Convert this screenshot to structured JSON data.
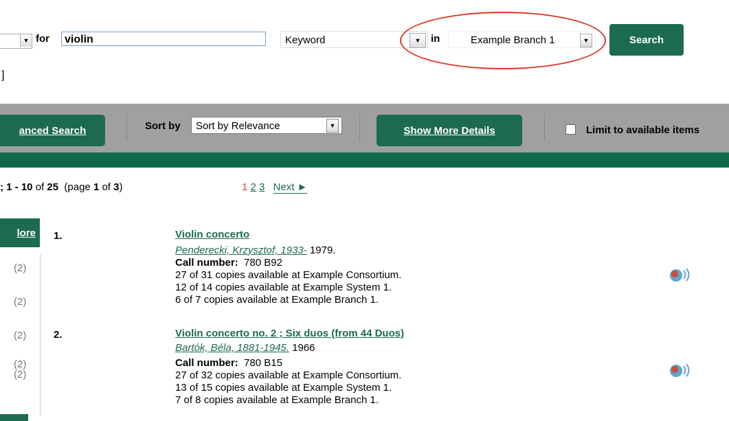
{
  "search": {
    "for_label": "for",
    "query": "violin",
    "field": "Keyword",
    "in_label": "in",
    "branch": "Example Branch 1",
    "button": "Search",
    "stub_text": "]"
  },
  "toolbar": {
    "advanced": "anced Search",
    "sort_label": "Sort by",
    "sort_value": "Sort by Relevance",
    "details": "Show More Details",
    "limit_label": "Limit to available items"
  },
  "summary": {
    "prefix": "; 1 - 10",
    "of": " of ",
    "total": "25",
    "page_open": "  (page ",
    "page": "1",
    "page_of": " of ",
    "pages": "3",
    "page_close": ")"
  },
  "pager": {
    "current": "1",
    "p2": "2",
    "p3": "3",
    "next": "Next ►"
  },
  "facets": {
    "more": "lore",
    "counts": [
      "(2)",
      "(2)",
      "(2)",
      "(2)",
      "(2)"
    ]
  },
  "results": [
    {
      "num": "1.",
      "title": "Violin concerto",
      "author": "Penderecki, Krzysztof, 1933-",
      "year": " 1979.",
      "call_label": "Call number:",
      "call": "780 B92",
      "avail": [
        "27 of 31 copies available at Example Consortium.",
        "12 of 14 copies available at Example System 1.",
        "6 of 7 copies available at Example Branch 1."
      ]
    },
    {
      "num": "2.",
      "title": "Violin concerto no. 2 ; Six duos (from 44 Duos)",
      "author": "Bartók, Béla, 1881-1945.",
      "year": " 1966",
      "call_label": "Call number:",
      "call": "780 B15",
      "avail": [
        "27 of 32 copies available at Example Consortium.",
        "13 of 15 copies available at Example System 1.",
        "7 of 8 copies available at Example Branch 1."
      ]
    }
  ],
  "colors": {
    "brand_green": "#1d6b4f",
    "toolbar_gray": "#a0a0a0",
    "annotation_red": "#d63b2a",
    "current_page": "#d9432b"
  },
  "icons": {
    "dropdown": "dropdown-arrow-icon",
    "sound": "sound-recording-icon"
  }
}
